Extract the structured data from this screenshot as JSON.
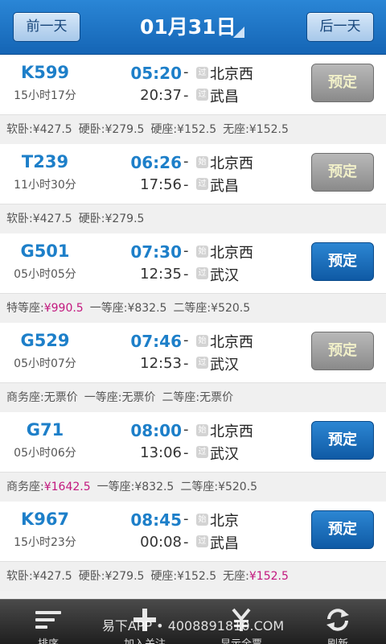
{
  "header": {
    "prev_label": "前一天",
    "date": "01月31日",
    "next_label": "后一天"
  },
  "trains": [
    {
      "code": "K599",
      "duration": "15小时17分",
      "dep_time": "05:20",
      "arr_time": "20:37",
      "dep_tag": "过",
      "arr_tag": "过",
      "from": "北京西",
      "to": "武昌",
      "book_label": "预定",
      "book_state": "gray",
      "prices": [
        {
          "label": "软卧:",
          "value": "¥427.5",
          "highlight": false
        },
        {
          "label": "硬卧:",
          "value": "¥279.5",
          "highlight": false
        },
        {
          "label": "硬座:",
          "value": "¥152.5",
          "highlight": false
        },
        {
          "label": "无座:",
          "value": "¥152.5",
          "highlight": false
        }
      ]
    },
    {
      "code": "T239",
      "duration": "11小时30分",
      "dep_time": "06:26",
      "arr_time": "17:56",
      "dep_tag": "始",
      "arr_tag": "过",
      "from": "北京西",
      "to": "武昌",
      "book_label": "预定",
      "book_state": "gray",
      "prices": [
        {
          "label": "软卧:",
          "value": "¥427.5",
          "highlight": false
        },
        {
          "label": "硬卧:",
          "value": "¥279.5",
          "highlight": false
        }
      ]
    },
    {
      "code": "G501",
      "duration": "05小时05分",
      "dep_time": "07:30",
      "arr_time": "12:35",
      "dep_tag": "始",
      "arr_tag": "过",
      "from": "北京西",
      "to": "武汉",
      "book_label": "预定",
      "book_state": "blue",
      "prices": [
        {
          "label": "特等座:",
          "value": "¥990.5",
          "highlight": true
        },
        {
          "label": "一等座:",
          "value": "¥832.5",
          "highlight": false
        },
        {
          "label": "二等座:",
          "value": "¥520.5",
          "highlight": false
        }
      ]
    },
    {
      "code": "G529",
      "duration": "05小时07分",
      "dep_time": "07:46",
      "arr_time": "12:53",
      "dep_tag": "始",
      "arr_tag": "过",
      "from": "北京西",
      "to": "武汉",
      "book_label": "预定",
      "book_state": "gray",
      "prices": [
        {
          "label": "商务座:",
          "value": "无票价",
          "highlight": false
        },
        {
          "label": "一等座:",
          "value": "无票价",
          "highlight": false
        },
        {
          "label": "二等座:",
          "value": "无票价",
          "highlight": false
        }
      ]
    },
    {
      "code": "G71",
      "duration": "05小时06分",
      "dep_time": "08:00",
      "arr_time": "13:06",
      "dep_tag": "始",
      "arr_tag": "过",
      "from": "北京西",
      "to": "武汉",
      "book_label": "预定",
      "book_state": "blue",
      "prices": [
        {
          "label": "商务座:",
          "value": "¥1642.5",
          "highlight": true
        },
        {
          "label": "一等座:",
          "value": "¥832.5",
          "highlight": false
        },
        {
          "label": "二等座:",
          "value": "¥520.5",
          "highlight": false
        }
      ]
    },
    {
      "code": "K967",
      "duration": "15小时23分",
      "dep_time": "08:45",
      "arr_time": "00:08",
      "dep_tag": "始",
      "arr_tag": "过",
      "from": "北京",
      "to": "武昌",
      "book_label": "预定",
      "book_state": "blue",
      "prices": [
        {
          "label": "软卧:",
          "value": "¥427.5",
          "highlight": false
        },
        {
          "label": "硬卧:",
          "value": "¥279.5",
          "highlight": false
        },
        {
          "label": "硬座:",
          "value": "¥152.5",
          "highlight": false
        },
        {
          "label": "无座:",
          "value": "¥152.5",
          "highlight": true
        }
      ]
    }
  ],
  "toolbar": {
    "items": [
      {
        "icon": "sort-icon",
        "label": "排序"
      },
      {
        "icon": "add-icon",
        "label": "加入关注"
      },
      {
        "icon": "yen-icon",
        "label": "显示全票"
      },
      {
        "icon": "refresh-icon",
        "label": "刷新"
      }
    ]
  },
  "watermark": "易下APP • 4008891810.COM"
}
